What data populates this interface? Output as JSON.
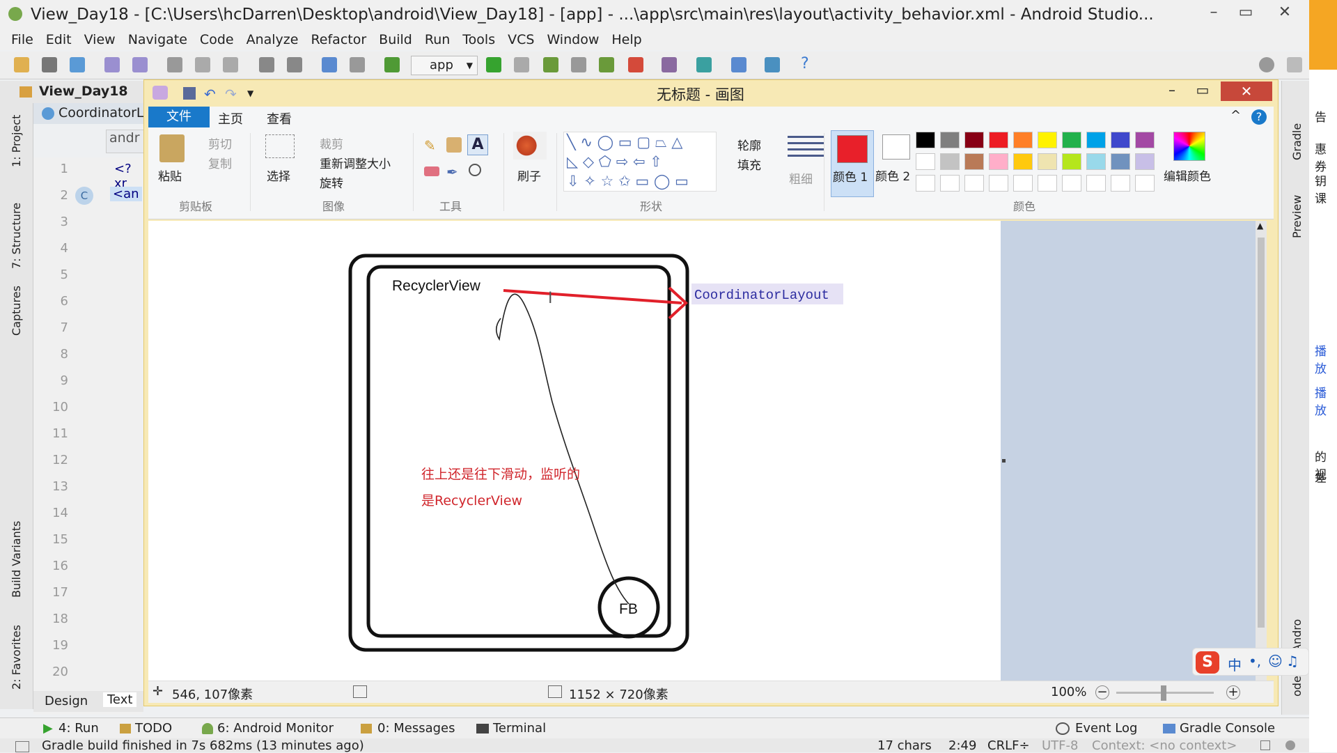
{
  "window": {
    "title": "View_Day18 - [C:\\Users\\hcDarren\\Desktop\\android\\View_Day18] - [app] - ...\\app\\src\\main\\res\\layout\\activity_behavior.xml - Android Studio..."
  },
  "menu": [
    "File",
    "Edit",
    "View",
    "Navigate",
    "Code",
    "Analyze",
    "Refactor",
    "Build",
    "Run",
    "Tools",
    "VCS",
    "Window",
    "Help"
  ],
  "toolbar": {
    "run_config": "app"
  },
  "nav": {
    "project": "View_Day18",
    "file_tab": "CoordinatorL"
  },
  "left_tools": [
    "1: Project",
    "7: Structure",
    "Captures",
    "Build Variants",
    "2: Favorites"
  ],
  "right_tools": [
    "Gradle",
    "Preview",
    "Andro",
    "odel"
  ],
  "editor": {
    "line_numbers": [
      "1",
      "2",
      "3",
      "4",
      "5",
      "6",
      "7",
      "8",
      "9",
      "10",
      "11",
      "12",
      "13",
      "14",
      "15",
      "16",
      "17",
      "18",
      "19",
      "20"
    ],
    "code_prefix": "andr",
    "line1": "<?xr",
    "line2": "<an",
    "tabs": [
      "Design",
      "Text"
    ]
  },
  "paint": {
    "title": "无标题 - 画图",
    "tabs": [
      "文件",
      "主页",
      "查看"
    ],
    "clipboard": {
      "paste": "粘贴",
      "cut": "剪切",
      "copy": "复制",
      "group": "剪贴板"
    },
    "image": {
      "select": "选择",
      "crop": "裁剪",
      "resize": "重新调整大小",
      "rotate": "旋转",
      "group": "图像"
    },
    "tools": {
      "group": "工具"
    },
    "brush": "刷子",
    "shapes": {
      "outline": "轮廓",
      "fill": "填充",
      "group": "形状"
    },
    "size": "粗细",
    "color1": "颜色 1",
    "color2": "颜色 2",
    "edit_colors": "编辑颜色",
    "colors_group": "颜色",
    "color1_value": "#e8202a",
    "palette_row1": [
      "#000000",
      "#7f7f7f",
      "#880015",
      "#ed1c24",
      "#ff7f27",
      "#fff200",
      "#22b14c",
      "#00a2e8",
      "#3f48cc",
      "#a349a4"
    ],
    "palette_row2": [
      "#ffffff",
      "#c3c3c3",
      "#b97a57",
      "#ffaec9",
      "#ffc90e",
      "#efe4b0",
      "#b5e61d",
      "#99d9ea",
      "#7092be",
      "#c8bfe7"
    ],
    "status": {
      "position": "546, 107像素",
      "size": "1152 × 720像素",
      "zoom": "100%"
    }
  },
  "drawing": {
    "recycler": "RecyclerView",
    "coordinator": "CoordinatorLayout",
    "note_line1": "往上还是往下滑动，监听的",
    "note_line2": "是RecyclerView",
    "fab": "FB"
  },
  "bottom_tools": {
    "run": "4: Run",
    "todo": "TODO",
    "monitor": "6: Android Monitor",
    "messages": "0: Messages",
    "terminal": "Terminal",
    "event_log": "Event Log",
    "gradle_console": "Gradle Console"
  },
  "status": {
    "message": "Gradle build finished in 7s 682ms (13 minutes ago)",
    "chars": "17 chars",
    "position": "2:49",
    "line_sep": "CRLF÷",
    "encoding": "UTF-8",
    "context": "Context: <no context>"
  },
  "right_fragments": [
    "告",
    "惠券",
    "钥课",
    "播放",
    "播放",
    "的视",
    "差"
  ]
}
